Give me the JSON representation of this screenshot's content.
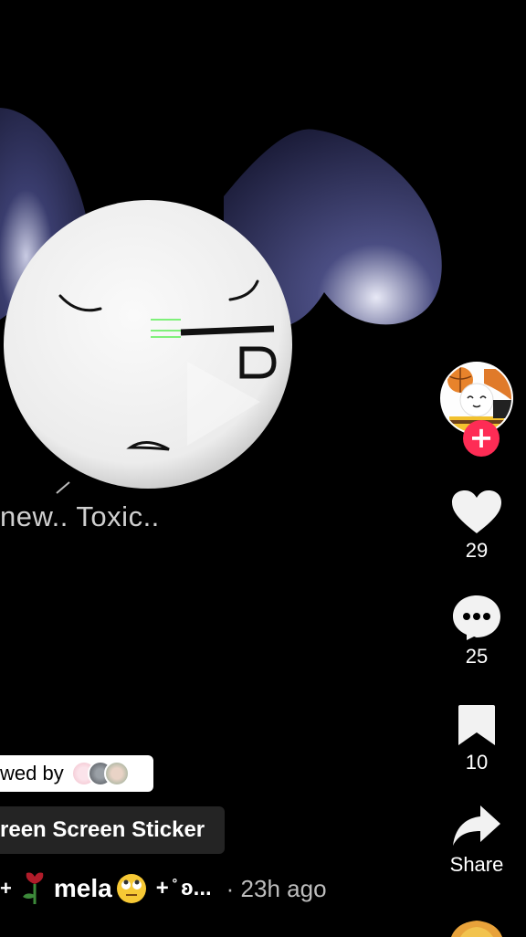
{
  "video": {
    "overlay_caption": "new.. Toxic.."
  },
  "creator": {
    "follow_symbol": "+"
  },
  "actions": [
    {
      "name": "like",
      "icon": "heart-icon",
      "count": "29"
    },
    {
      "name": "comment",
      "icon": "comment-dots-icon",
      "count": "25"
    },
    {
      "name": "save",
      "icon": "bookmark-icon",
      "count": "10"
    },
    {
      "name": "share",
      "icon": "share-arrow-icon",
      "count": "Share"
    }
  ],
  "viewed_by": {
    "label": "wed by"
  },
  "sticker": {
    "label": "reen Screen Sticker"
  },
  "post": {
    "prefix_deco": "+",
    "username": "mela",
    "suffix_deco": "+ ̊ ʚ...",
    "timestamp": "· 23h ago"
  },
  "colors": {
    "background": "#000000",
    "follow_accent": "#fe2c55",
    "ear_color": "#2b2d52",
    "face_color": "#f2f2f2"
  }
}
